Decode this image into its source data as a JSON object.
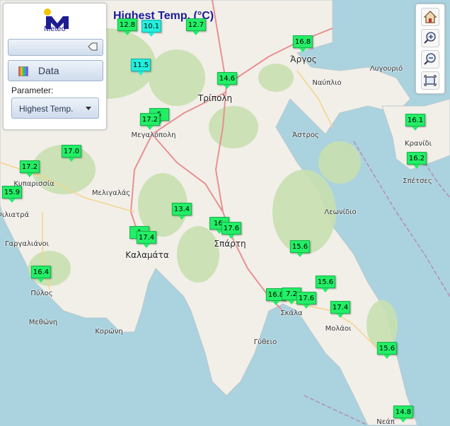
{
  "title": "Highest Temp. (°C)",
  "panel": {
    "logo_text": "Meteo",
    "data_button": "Data",
    "parameter_label": "Parameter:",
    "parameter_value": "Highest Temp."
  },
  "toolbar": {
    "icons": [
      "home-icon",
      "zoom-in-icon",
      "zoom-out-icon",
      "extent-icon"
    ]
  },
  "colors": {
    "sea": "#aad3df",
    "land": "#f2efe9",
    "forest": "#c8e0b0",
    "marker_green": "#22ee66",
    "marker_cyan": "#22eedd",
    "title": "#1a1a9c"
  },
  "places": [
    {
      "name": "Τρίπολη",
      "big": true
    },
    {
      "name": "Άργος",
      "big": true
    },
    {
      "name": "Ναύπλιο",
      "big": false
    },
    {
      "name": "Λυγουριό",
      "big": false
    },
    {
      "name": "Μεγαλόπολη",
      "big": false
    },
    {
      "name": "Άστρος",
      "big": false
    },
    {
      "name": "Κρανίδι",
      "big": false
    },
    {
      "name": "Σπέτσες",
      "big": false
    },
    {
      "name": "Κυπαρισσία",
      "big": false
    },
    {
      "name": "Μελιγαλάς",
      "big": false
    },
    {
      "name": "Φιλιατρά",
      "big": false
    },
    {
      "name": "Λεωνίδιο",
      "big": false
    },
    {
      "name": "Γαργαλιάνοι",
      "big": false
    },
    {
      "name": "Καλαμάτα",
      "big": true
    },
    {
      "name": "Σπάρτη",
      "big": true
    },
    {
      "name": "Πύλος",
      "big": false
    },
    {
      "name": "Σκάλα",
      "big": false
    },
    {
      "name": "Μεθώνη",
      "big": false
    },
    {
      "name": "Μολάοι",
      "big": false
    },
    {
      "name": "Κορώνη",
      "big": false
    },
    {
      "name": "Γύθειο",
      "big": false
    },
    {
      "name": "Νεάπ",
      "big": false
    }
  ],
  "stations": [
    {
      "value": "12.8",
      "color": "green"
    },
    {
      "value": "10.1",
      "color": "cyan"
    },
    {
      "value": "12.7",
      "color": "green"
    },
    {
      "value": "16.8",
      "color": "green"
    },
    {
      "value": "11.5",
      "color": "cyan"
    },
    {
      "value": "14.6",
      "color": "green"
    },
    {
      "value": "5",
      "color": "green"
    },
    {
      "value": "17.2",
      "color": "green"
    },
    {
      "value": "16.1",
      "color": "green"
    },
    {
      "value": "17.0",
      "color": "green"
    },
    {
      "value": "16.2",
      "color": "green"
    },
    {
      "value": "17.2",
      "color": "green"
    },
    {
      "value": "15.9",
      "color": "green"
    },
    {
      "value": "13.4",
      "color": "green"
    },
    {
      "value": "16.",
      "color": "green"
    },
    {
      "value": "17.6",
      "color": "green"
    },
    {
      "value": "1",
      "color": "green"
    },
    {
      "value": "17.4",
      "color": "green"
    },
    {
      "value": "15.6",
      "color": "green"
    },
    {
      "value": "16.4",
      "color": "green"
    },
    {
      "value": "15.6",
      "color": "green"
    },
    {
      "value": "16.8",
      "color": "green"
    },
    {
      "value": "7.2",
      "color": "green"
    },
    {
      "value": "17.6",
      "color": "green"
    },
    {
      "value": "17.4",
      "color": "green"
    },
    {
      "value": "15.6",
      "color": "green"
    },
    {
      "value": "14.8",
      "color": "green"
    }
  ]
}
